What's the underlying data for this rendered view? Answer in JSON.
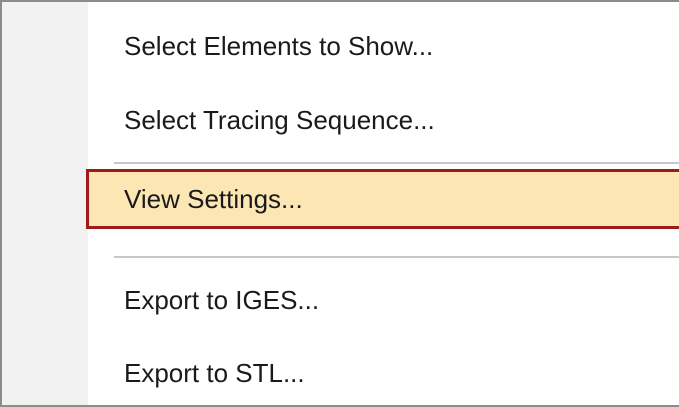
{
  "context_menu": {
    "items": [
      {
        "label": "Select Elements to Show..."
      },
      {
        "label": "Select Tracing Sequence..."
      },
      {
        "label": "View Settings...",
        "highlighted": true
      },
      {
        "label": "Export to IGES..."
      },
      {
        "label": "Export to STL..."
      }
    ],
    "colors": {
      "highlight_fill": "#fbe6b4",
      "highlight_border": "#9e1b1b",
      "separator": "#c8c8c8",
      "gutter": "#f2f2f2"
    }
  }
}
